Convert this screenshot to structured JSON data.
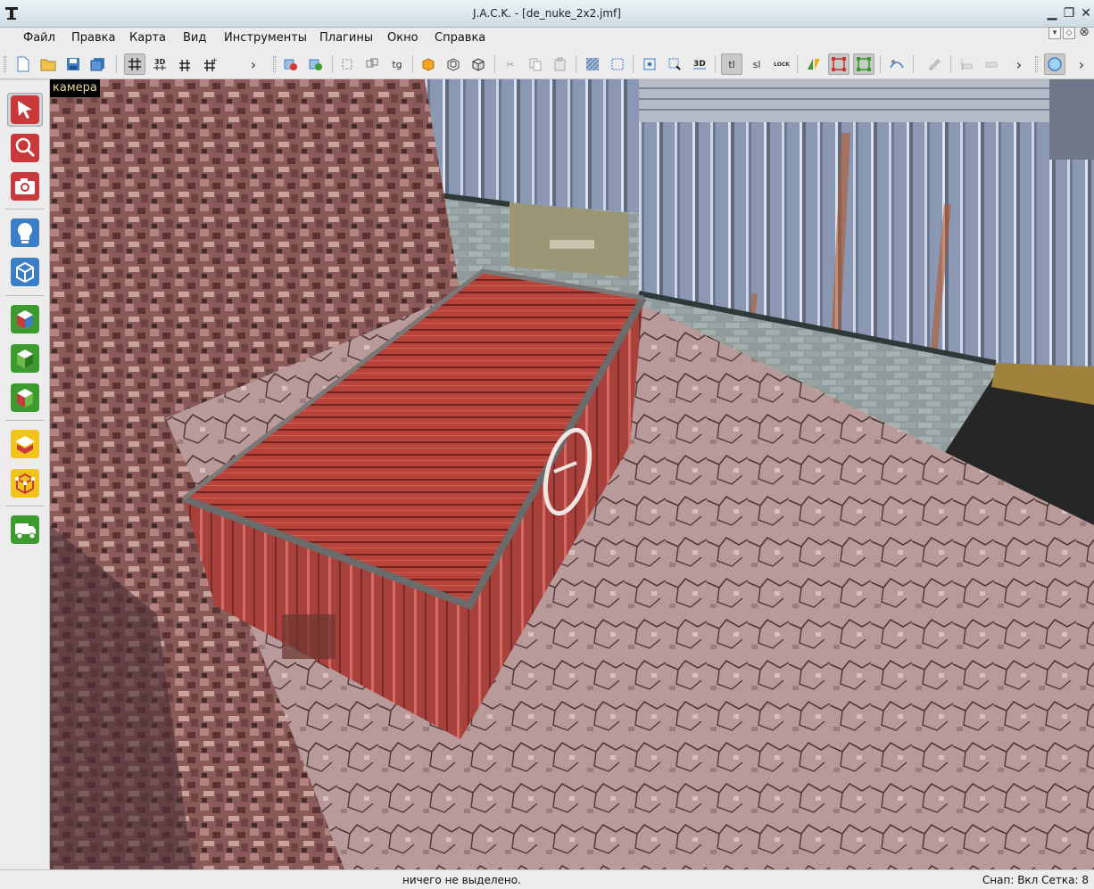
{
  "window": {
    "title": "J.A.C.K. - [de_nuke_2x2.jmf]"
  },
  "menu": {
    "items": [
      "Файл",
      "Правка",
      "Карта",
      "Вид",
      "Инструменты",
      "Плагины",
      "Окно",
      "Справка"
    ]
  },
  "toolbar": {
    "tl_label": "tl",
    "sl_label": "sl",
    "lock_label": "LOCK",
    "tg_label": "tg",
    "3d_label": "3D"
  },
  "viewport": {
    "label": "камера"
  },
  "status": {
    "message": "ничего не выделено.",
    "snap": "Снап: Вкл Сетка: 8"
  },
  "colors": {
    "titlebar": "#d9e6ee",
    "accent_red": "#c9383a",
    "accent_green": "#3c9a2e",
    "accent_blue": "#3b7ec6"
  }
}
